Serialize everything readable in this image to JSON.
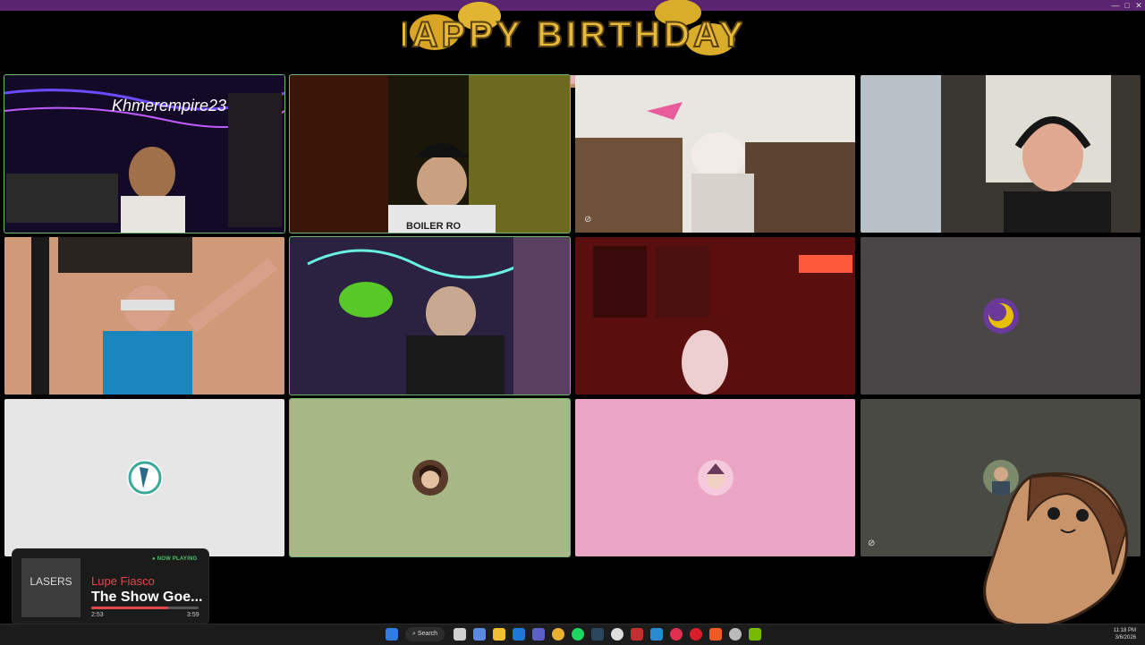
{
  "window": {
    "minimize_icon": "—",
    "maximize_icon": "□",
    "close_icon": "✕"
  },
  "banner": {
    "text": "HAPPY BIRTHDAY!"
  },
  "tiles": [
    {
      "name": "participant-1",
      "type": "video",
      "sign": "Khmerempire23",
      "bg": "#1a1030"
    },
    {
      "name": "participant-2",
      "type": "video",
      "shirt": "BOILER RO",
      "bg": "#2a2410"
    },
    {
      "name": "participant-3",
      "type": "video",
      "bg": "#6b5a48"
    },
    {
      "name": "participant-4",
      "type": "video",
      "bg": "#4a4440"
    },
    {
      "name": "participant-5",
      "type": "video",
      "bg": "#b07060"
    },
    {
      "name": "participant-6",
      "type": "video",
      "bg": "#38304a"
    },
    {
      "name": "participant-7",
      "type": "video",
      "bg": "#7a1818"
    },
    {
      "name": "participant-8",
      "type": "avatar",
      "bg": "#4a4648"
    },
    {
      "name": "participant-9",
      "type": "avatar",
      "bg": "#e6e6e6"
    },
    {
      "name": "participant-10",
      "type": "avatar",
      "bg": "#a7b886"
    },
    {
      "name": "participant-11",
      "type": "avatar",
      "bg": "#eaa4c4"
    },
    {
      "name": "participant-12",
      "type": "avatar",
      "bg": "#4a4a44"
    }
  ],
  "now_playing": {
    "badge": "● NOW PLAYING",
    "art_label": "LASERS",
    "artist": "Lupe Fiasco",
    "title": "The Show Goe...",
    "elapsed": "2:53",
    "total": "3:59",
    "progress": 0.72
  },
  "taskbar": {
    "search_label": "Search",
    "time": "11:18 PM",
    "date": "3/6/2026",
    "apps": [
      "start-icon",
      "file-icon",
      "copilot-icon",
      "folder-icon",
      "outlook-icon",
      "teams-icon",
      "chrome-icon",
      "spotify-icon",
      "steam-icon",
      "github-icon",
      "vivaldi-icon",
      "vscode-icon",
      "app-red-icon",
      "opera-icon",
      "brave-icon",
      "settings-icon",
      "nvidia-icon"
    ]
  },
  "colors": {
    "active_border": "#6fb56c",
    "accent": "#5a2470"
  }
}
